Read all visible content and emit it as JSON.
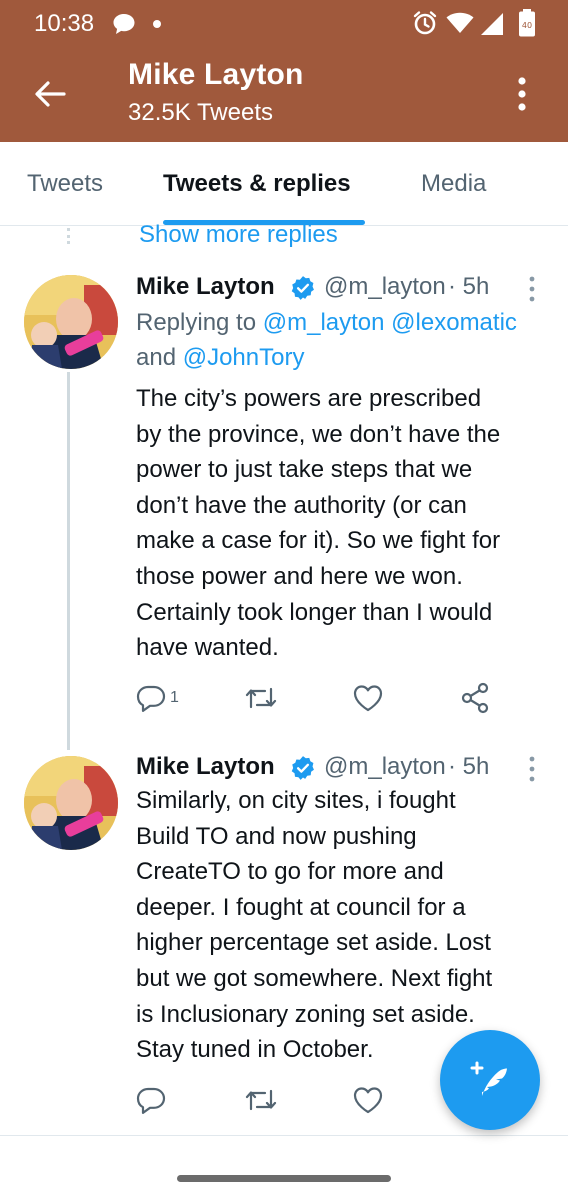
{
  "status_bar": {
    "time": "10:38",
    "battery_level": "40"
  },
  "header": {
    "title": "Mike Layton",
    "subtitle": "32.5K Tweets"
  },
  "tabs": [
    {
      "label": "Tweets"
    },
    {
      "label": "Tweets & replies",
      "active": true
    },
    {
      "label": "Media"
    }
  ],
  "feed": {
    "show_more": "Show more replies",
    "tweets": [
      {
        "name": "Mike Layton",
        "handle": "@m_layton",
        "time": "· 5h",
        "replying_prefix": "Replying to ",
        "replying_user1": "@m_layton",
        "replying_user2": "@lexomatic",
        "replying_and": "and ",
        "replying_user3": "@JohnTory",
        "text": "The city’s powers are prescribed\nby the province, we don’t have the\npower to just take steps that we\ndon’t have the authority (or can\nmake a case for it). So we fight for\nthose power and here we won.\nCertainly took longer than I would\nhave wanted.",
        "reply_count": "1"
      },
      {
        "name": "Mike Layton",
        "handle": "@m_layton",
        "time": "· 5h",
        "text": "Similarly, on city sites, i fought\nBuild TO and now pushing\nCreateTO to go for more and\ndeeper.  I fought at council for a\nhigher percentage set aside. Lost\nbut we got somewhere. Next fight\nis Inclusionary zoning set aside.\nStay tuned in October."
      }
    ]
  },
  "colors": {
    "header_bg": "#a0593c",
    "accent": "#1d9bf0",
    "secondary_text": "#536471"
  },
  "icons": [
    "back-arrow-icon",
    "more-vertical-icon",
    "verified-icon",
    "reply-icon",
    "retweet-icon",
    "like-icon",
    "share-icon",
    "compose-icon"
  ]
}
